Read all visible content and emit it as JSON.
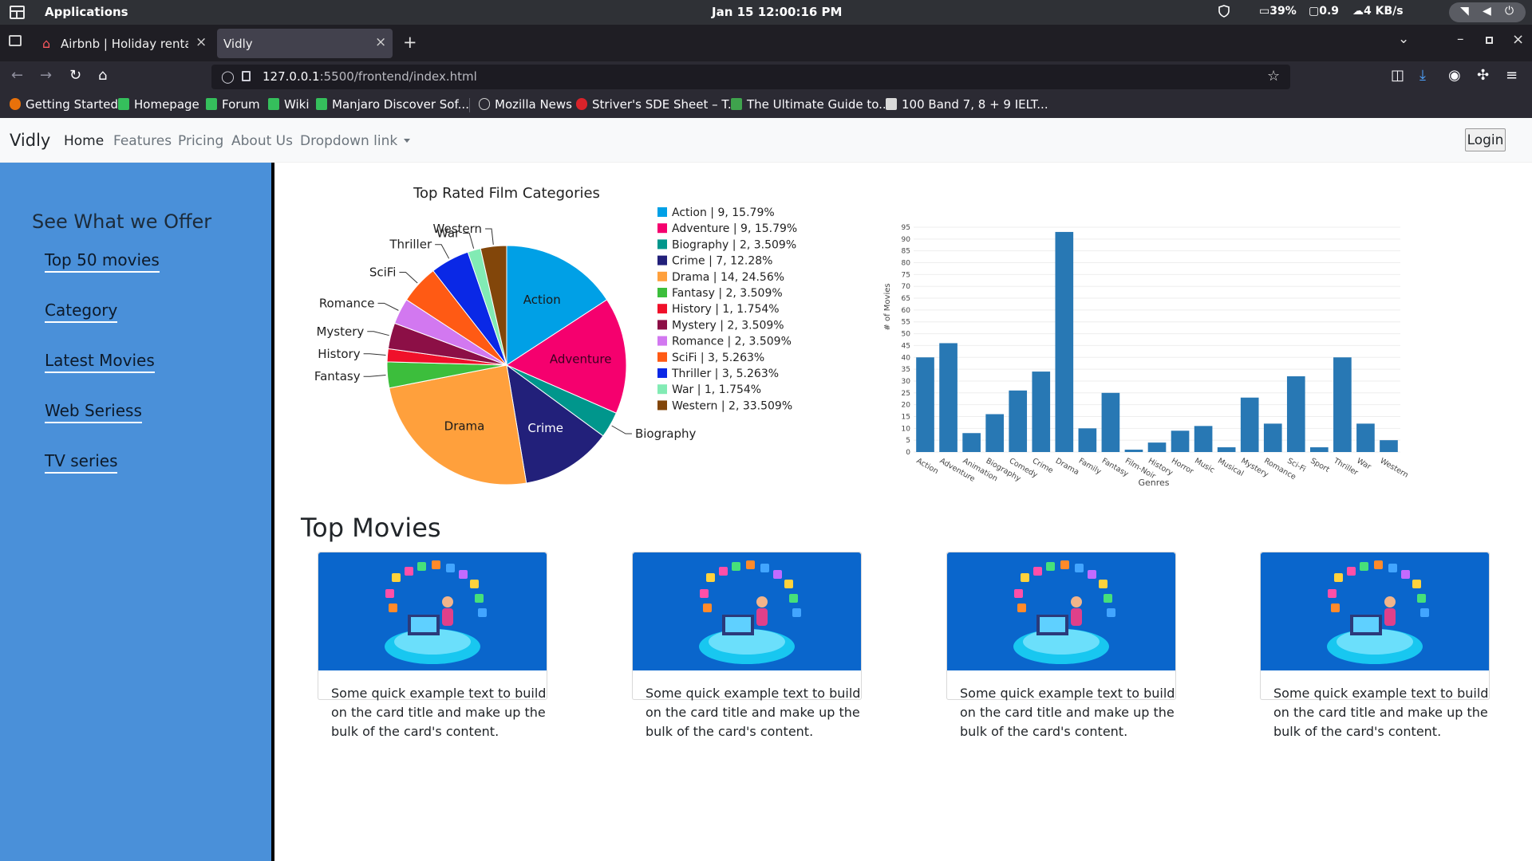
{
  "system_bar": {
    "apps_label": "Applications",
    "clock": "Jan 15  12:00:16 PM",
    "battery": "39%",
    "display": "0.9",
    "network": "4 KB/s"
  },
  "browser": {
    "tabs": [
      {
        "label": "Airbnb | Holiday rentals",
        "active": false
      },
      {
        "label": "Vidly",
        "active": true
      }
    ],
    "url_host": "127.0.0.1",
    "url_path": ":5500/frontend/index.html",
    "bookmarks": [
      {
        "label": "Getting Started",
        "icon": "firefox-icon",
        "color": "#e8710a"
      },
      {
        "label": "Homepage",
        "icon": "manjaro-icon",
        "color": "#35bf5c"
      },
      {
        "label": "Forum",
        "icon": "manjaro-icon",
        "color": "#35bf5c"
      },
      {
        "label": "Wiki",
        "icon": "manjaro-icon",
        "color": "#35bf5c"
      },
      {
        "label": "Manjaro Discover Sof...",
        "icon": "manjaro-icon",
        "color": "#35bf5c"
      },
      {
        "label": "Mozilla News",
        "icon": "globe-icon",
        "color": "#cfcfcf"
      },
      {
        "label": "Striver's SDE Sheet – T...",
        "icon": "tuf-icon",
        "color": "#d9232a"
      },
      {
        "label": "The Ultimate Guide to...",
        "icon": "page-icon",
        "color": "#3fa34d"
      },
      {
        "label": "100 Band 7, 8 + 9 IELT...",
        "icon": "image-icon",
        "color": "#d9d9d9"
      }
    ]
  },
  "site": {
    "brand": "Vidly",
    "nav": [
      "Home",
      "Features",
      "Pricing",
      "About Us",
      "Dropdown link"
    ],
    "login": "Login"
  },
  "sidebar": {
    "title": "See What we Offer",
    "links": [
      "Top 50 movies",
      "Category",
      "Latest Movies",
      "Web Seriess",
      "TV series"
    ]
  },
  "chart_data": [
    {
      "type": "pie",
      "title": "Top Rated Film Categories",
      "categories": [
        "Action",
        "Adventure",
        "Biography",
        "Crime",
        "Drama",
        "Fantasy",
        "History",
        "Mystery",
        "Romance",
        "SciFi",
        "Thriller",
        "War",
        "Western"
      ],
      "values": [
        9,
        9,
        2,
        7,
        14,
        2,
        1,
        2,
        2,
        3,
        3,
        1,
        2
      ],
      "legend": [
        "Action | 9, 15.79%",
        "Adventure | 9, 15.79%",
        "Biography | 2, 3.509%",
        "Crime | 7, 12.28%",
        "Drama | 14, 24.56%",
        "Fantasy | 2, 3.509%",
        "History | 1, 1.754%",
        "Mystery | 2, 3.509%",
        "Romance | 2, 3.509%",
        "SciFi | 3, 5.263%",
        "Thriller | 3, 5.263%",
        "War | 1, 1.754%",
        "Western | 2, 33.509%"
      ],
      "colors": [
        "#00a0e6",
        "#f5006e",
        "#00968c",
        "#22207a",
        "#ffa03c",
        "#3cbe3c",
        "#f0102a",
        "#8c0f46",
        "#d278f0",
        "#ff5a14",
        "#0a28e6",
        "#82ebb4",
        "#82460a"
      ],
      "legend_position": "right"
    },
    {
      "type": "bar",
      "categories": [
        "Action",
        "Adventure",
        "Animation",
        "Biography",
        "Comedy",
        "Crime",
        "Drama",
        "Family",
        "Fantasy",
        "Film-Noir",
        "History",
        "Horror",
        "Music",
        "Musical",
        "Mystery",
        "Romance",
        "Sci-Fi",
        "Sport",
        "Thriller",
        "War",
        "Western"
      ],
      "values": [
        40,
        46,
        8,
        16,
        26,
        34,
        93,
        10,
        25,
        1,
        4,
        9,
        11,
        2,
        23,
        12,
        32,
        2,
        40,
        12,
        5
      ],
      "xlabel": "Genres",
      "ylabel": "# of Movies",
      "ylim": [
        0,
        95
      ],
      "yticks": [
        0,
        5,
        10,
        15,
        20,
        25,
        30,
        35,
        40,
        45,
        50,
        55,
        60,
        65,
        70,
        75,
        80,
        85,
        90,
        95
      ],
      "color": "#2878b4",
      "grid": true
    }
  ],
  "top_movies": {
    "title": "Top Movies",
    "cards": [
      {
        "text": "Some quick example text to build on the card title and make up the bulk of the card's content."
      },
      {
        "text": "Some quick example text to build on the card title and make up the bulk of the card's content."
      },
      {
        "text": "Some quick example text to build on the card title and make up the bulk of the card's content."
      },
      {
        "text": "Some quick example text to build on the card title and make up the bulk of the card's content."
      }
    ]
  }
}
